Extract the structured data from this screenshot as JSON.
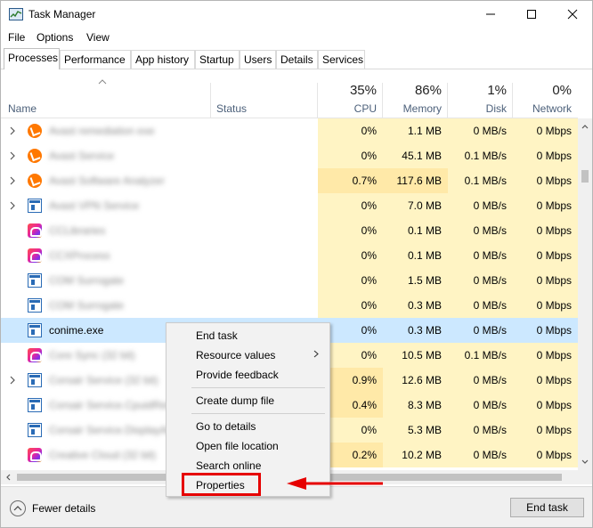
{
  "window": {
    "title": "Task Manager",
    "controls": [
      "minimize-icon",
      "maximize-icon",
      "close-icon"
    ]
  },
  "menu": [
    "File",
    "Options",
    "View"
  ],
  "tabs": [
    "Processes",
    "Performance",
    "App history",
    "Startup",
    "Users",
    "Details",
    "Services"
  ],
  "active_tab": "Processes",
  "header": {
    "name": "Name",
    "status": "Status",
    "cpu": {
      "pct": "35%",
      "label": "CPU"
    },
    "memory": {
      "pct": "86%",
      "label": "Memory"
    },
    "disk": {
      "pct": "1%",
      "label": "Disk"
    },
    "network": {
      "pct": "0%",
      "label": "Network"
    }
  },
  "processes": [
    {
      "name": "Avast remediation exe",
      "blurred": true,
      "icon": "avast-icon",
      "expandable": true,
      "cpu": "0%",
      "memory": "1.1 MB",
      "disk": "0 MB/s",
      "network": "0 Mbps"
    },
    {
      "name": "Avast Service",
      "blurred": true,
      "icon": "avast-icon",
      "expandable": true,
      "cpu": "0%",
      "memory": "45.1 MB",
      "disk": "0.1 MB/s",
      "network": "0 Mbps"
    },
    {
      "name": "Avast Software Analyzer",
      "blurred": true,
      "icon": "avast-icon",
      "expandable": true,
      "cpu": "0.7%",
      "memory": "117.6 MB",
      "disk": "0.1 MB/s",
      "network": "0 Mbps"
    },
    {
      "name": "Avast VPN Service",
      "blurred": true,
      "icon": "app-window-icon",
      "expandable": true,
      "cpu": "0%",
      "memory": "7.0 MB",
      "disk": "0 MB/s",
      "network": "0 Mbps"
    },
    {
      "name": "CCLibraries",
      "blurred": true,
      "icon": "creative-cloud-icon",
      "expandable": false,
      "cpu": "0%",
      "memory": "0.1 MB",
      "disk": "0 MB/s",
      "network": "0 Mbps"
    },
    {
      "name": "CCXProcess",
      "blurred": true,
      "icon": "creative-cloud-icon",
      "expandable": false,
      "cpu": "0%",
      "memory": "0.1 MB",
      "disk": "0 MB/s",
      "network": "0 Mbps"
    },
    {
      "name": "COM Surrogate",
      "blurred": true,
      "icon": "app-window-icon",
      "expandable": false,
      "cpu": "0%",
      "memory": "1.5 MB",
      "disk": "0 MB/s",
      "network": "0 Mbps"
    },
    {
      "name": "COM Surrogate",
      "blurred": true,
      "icon": "app-window-icon",
      "expandable": false,
      "cpu": "0%",
      "memory": "0.3 MB",
      "disk": "0 MB/s",
      "network": "0 Mbps"
    },
    {
      "name": "conime.exe",
      "blurred": false,
      "selected": true,
      "icon": "app-window-icon",
      "expandable": false,
      "cpu": "0%",
      "memory": "0.3 MB",
      "disk": "0 MB/s",
      "network": "0 Mbps"
    },
    {
      "name": "Core Sync (32 bit)",
      "blurred": true,
      "icon": "creative-cloud-icon",
      "expandable": false,
      "cpu": "0%",
      "memory": "10.5 MB",
      "disk": "0.1 MB/s",
      "network": "0 Mbps"
    },
    {
      "name": "Corsair Service (32 bit)",
      "blurred": true,
      "icon": "app-window-icon",
      "expandable": true,
      "cpu": "0.9%",
      "memory": "12.6 MB",
      "disk": "0 MB/s",
      "network": "0 Mbps"
    },
    {
      "name": "Corsair Service.CpuidRemote",
      "blurred": true,
      "icon": "app-window-icon",
      "expandable": false,
      "cpu": "0.4%",
      "memory": "8.3 MB",
      "disk": "0 MB/s",
      "network": "0 Mbps"
    },
    {
      "name": "Corsair Service.DisplayAdapter",
      "blurred": true,
      "icon": "app-window-icon",
      "expandable": false,
      "cpu": "0%",
      "memory": "5.3 MB",
      "disk": "0 MB/s",
      "network": "0 Mbps"
    },
    {
      "name": "Creative Cloud (32 bit)",
      "blurred": true,
      "icon": "creative-cloud-icon",
      "expandable": false,
      "cpu": "0.2%",
      "memory": "10.2 MB",
      "disk": "0 MB/s",
      "network": "0 Mbps"
    }
  ],
  "context_menu": {
    "end_task": "End task",
    "resource_values": "Resource values",
    "provide_feedback": "Provide feedback",
    "create_dump": "Create dump file",
    "go_to_details": "Go to details",
    "open_file_location": "Open file location",
    "search_online": "Search online",
    "properties": "Properties"
  },
  "annotation": {
    "color": "#e60000",
    "target": "Properties"
  },
  "footer": {
    "fewer_details": "Fewer details",
    "end_task": "End task"
  },
  "colors": {
    "selected_row": "#cce8ff",
    "heat_light": "#fff4c4",
    "heat_medium": "#ffe9a8",
    "header_label": "#4c607a"
  }
}
